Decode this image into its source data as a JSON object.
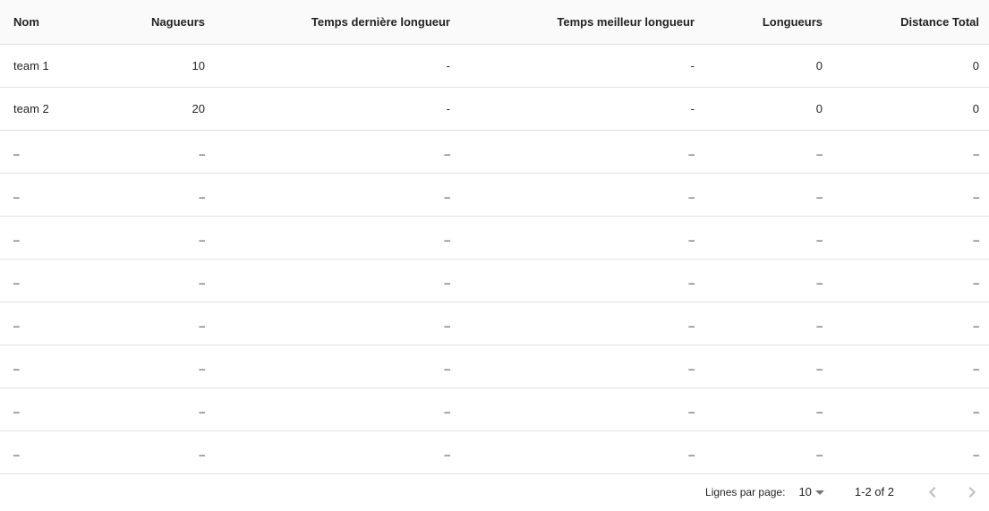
{
  "table": {
    "columns": [
      "Nom",
      "Nagueurs",
      "Temps dernière longueur",
      "Temps meilleur longueur",
      "Longueurs",
      "Distance Total"
    ],
    "rows": [
      [
        "team 1",
        "10",
        "-",
        "-",
        "0",
        "0"
      ],
      [
        "team 2",
        "20",
        "-",
        "-",
        "0",
        "0"
      ],
      [
        "–",
        "–",
        "–",
        "–",
        "–",
        "–"
      ],
      [
        "–",
        "–",
        "–",
        "–",
        "–",
        "–"
      ],
      [
        "–",
        "–",
        "–",
        "–",
        "–",
        "–"
      ],
      [
        "–",
        "–",
        "–",
        "–",
        "–",
        "–"
      ],
      [
        "–",
        "–",
        "–",
        "–",
        "–",
        "–"
      ],
      [
        "–",
        "–",
        "–",
        "–",
        "–",
        "–"
      ],
      [
        "–",
        "–",
        "–",
        "–",
        "–",
        "–"
      ],
      [
        "–",
        "–",
        "–",
        "–",
        "–",
        "–"
      ]
    ]
  },
  "pagination": {
    "rows_per_page_label": "Lignes par page:",
    "rows_per_page_value": "10",
    "range_label": "1-2 of 2",
    "prev_icon": "chevron-left-icon",
    "next_icon": "chevron-right-icon"
  },
  "colors": {
    "border": "#e0e0e0",
    "header_bg": "#fafafa",
    "icon_disabled": "#bdbdbd"
  }
}
